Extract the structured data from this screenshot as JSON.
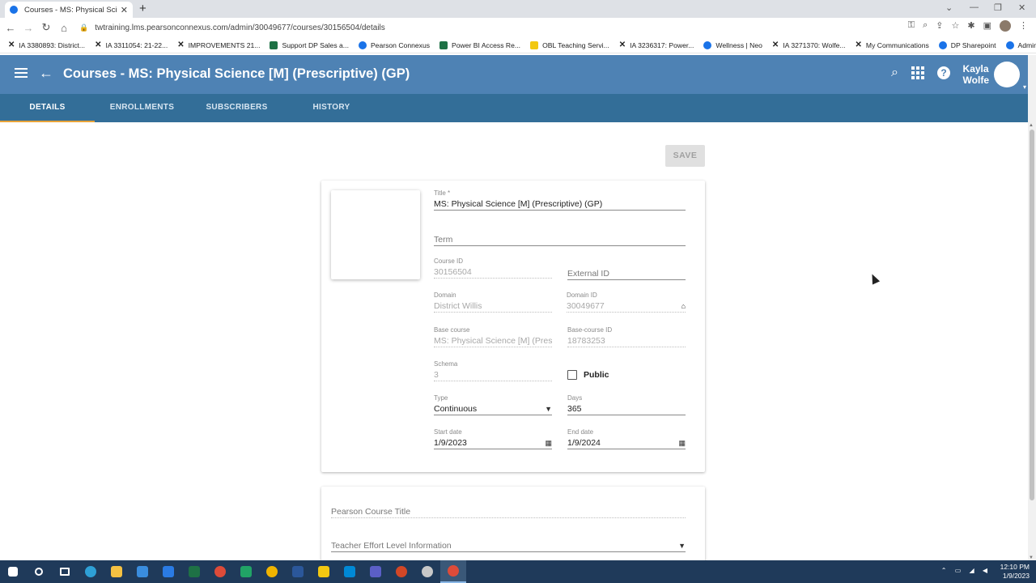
{
  "browser": {
    "tab_title": "Courses - MS: Physical Science [M] (Prescriptive) (GP)",
    "tab_close": "✕",
    "new_tab": "+",
    "url": "twtraining.lms.pearsonconnexus.com/admin/30049677/courses/30156504/details",
    "bookmarks": [
      "IA 3380893: District...",
      "IA 3311054: 21-22...",
      "IMPROVEMENTS 21...",
      "Support DP Sales a...",
      "Pearson Connexus",
      "Power BI Access Re...",
      "OBL Teaching Servi...",
      "IA 3236317: Power...",
      "Wellness | Neo",
      "IA 3271370: Wolfe...",
      "My Communications",
      "DP Sharepoint",
      "Admin App - Distric..."
    ]
  },
  "header": {
    "title": "Courses - MS: Physical Science [M] (Prescriptive) (GP)",
    "user_first": "Kayla",
    "user_last": "Wolfe"
  },
  "tabs": [
    "DETAILS",
    "ENROLLMENTS",
    "SUBSCRIBERS",
    "HISTORY"
  ],
  "save_label": "SAVE",
  "form": {
    "title_label": "Title *",
    "title_value": "MS: Physical Science [M] (Prescriptive) (GP)",
    "term_placeholder": "Term",
    "course_id_label": "Course ID",
    "course_id_value": "30156504",
    "external_id_placeholder": "External ID",
    "domain_label": "Domain",
    "domain_value": "District Willis",
    "domain_id_label": "Domain ID",
    "domain_id_value": "30049677",
    "base_course_label": "Base course",
    "base_course_value": "MS: Physical Science [M] (Prescriptive) (GP)",
    "base_course_id_label": "Base-course ID",
    "base_course_id_value": "18783253",
    "schema_label": "Schema",
    "schema_value": "3",
    "public_label": "Public",
    "type_label": "Type",
    "type_value": "Continuous",
    "days_label": "Days",
    "days_value": "365",
    "start_label": "Start date",
    "start_value": "1/9/2023",
    "end_label": "End date",
    "end_value": "1/9/2024"
  },
  "form2": {
    "pearson_title_placeholder": "Pearson Course Title",
    "effort_placeholder": "Teacher Effort Level Information"
  },
  "taskbar": {
    "time": "12:10 PM",
    "date": "1/9/2023"
  }
}
